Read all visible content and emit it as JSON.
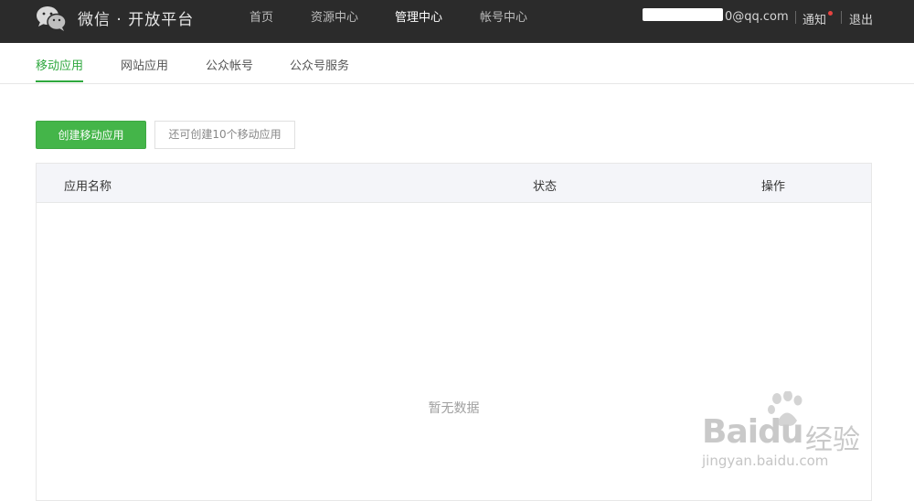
{
  "header": {
    "brand": "微信 · 开放平台",
    "nav": [
      "首页",
      "资源中心",
      "管理中心",
      "帐号中心"
    ],
    "active_nav": "管理中心",
    "account_email": "0@qq.com",
    "notify_label": "通知",
    "logout_label": "退出"
  },
  "subnav": {
    "tabs": [
      "移动应用",
      "网站应用",
      "公众帐号",
      "公众号服务"
    ],
    "active": "移动应用"
  },
  "actions": {
    "create_label": "创建移动应用",
    "quota_text": "还可创建10个移动应用"
  },
  "table": {
    "columns": [
      "应用名称",
      "状态",
      "操作"
    ],
    "empty_text": "暂无数据"
  },
  "watermark": {
    "logo_text": "Baidu",
    "logo_cn": "经验",
    "url": "jingyan.baidu.com"
  },
  "colors": {
    "topbar": "#2b2b2b",
    "accent": "#44b549",
    "notify_dot": "#e64340"
  },
  "icons": {
    "logo": "wechat-logo-icon",
    "notify": "notification-dot-icon",
    "watermark": "baidu-paw-icon"
  }
}
